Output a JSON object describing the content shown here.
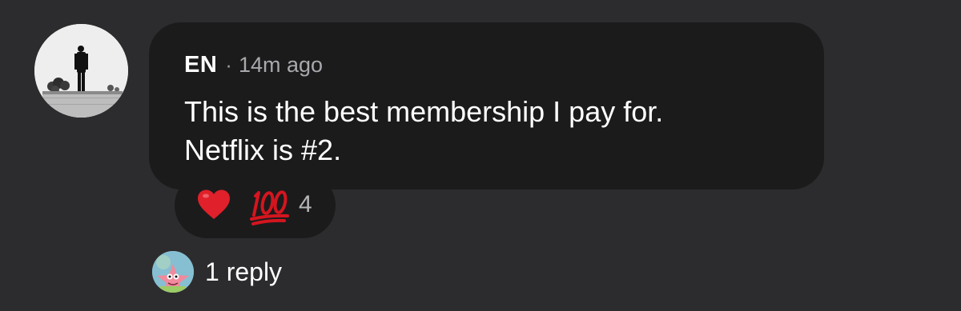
{
  "comment": {
    "author": "EN",
    "separator": "·",
    "timestamp": "14m ago",
    "text_line_1": "This is the best membership I pay for.",
    "text_line_2": "Netflix is #2.",
    "avatar_icon": "silhouette-person-avatar"
  },
  "reactions": {
    "items": [
      {
        "icon": "red-heart-emoji"
      },
      {
        "icon": "hundred-points-emoji"
      }
    ],
    "count": "4"
  },
  "replies": {
    "label": "1 reply",
    "avatar_icon": "cartoon-star-avatar"
  },
  "colors": {
    "background": "#2c2c2e",
    "bubble": "#1b1b1c",
    "muted_text": "#a9a9ad",
    "heart": "#e0202a"
  }
}
